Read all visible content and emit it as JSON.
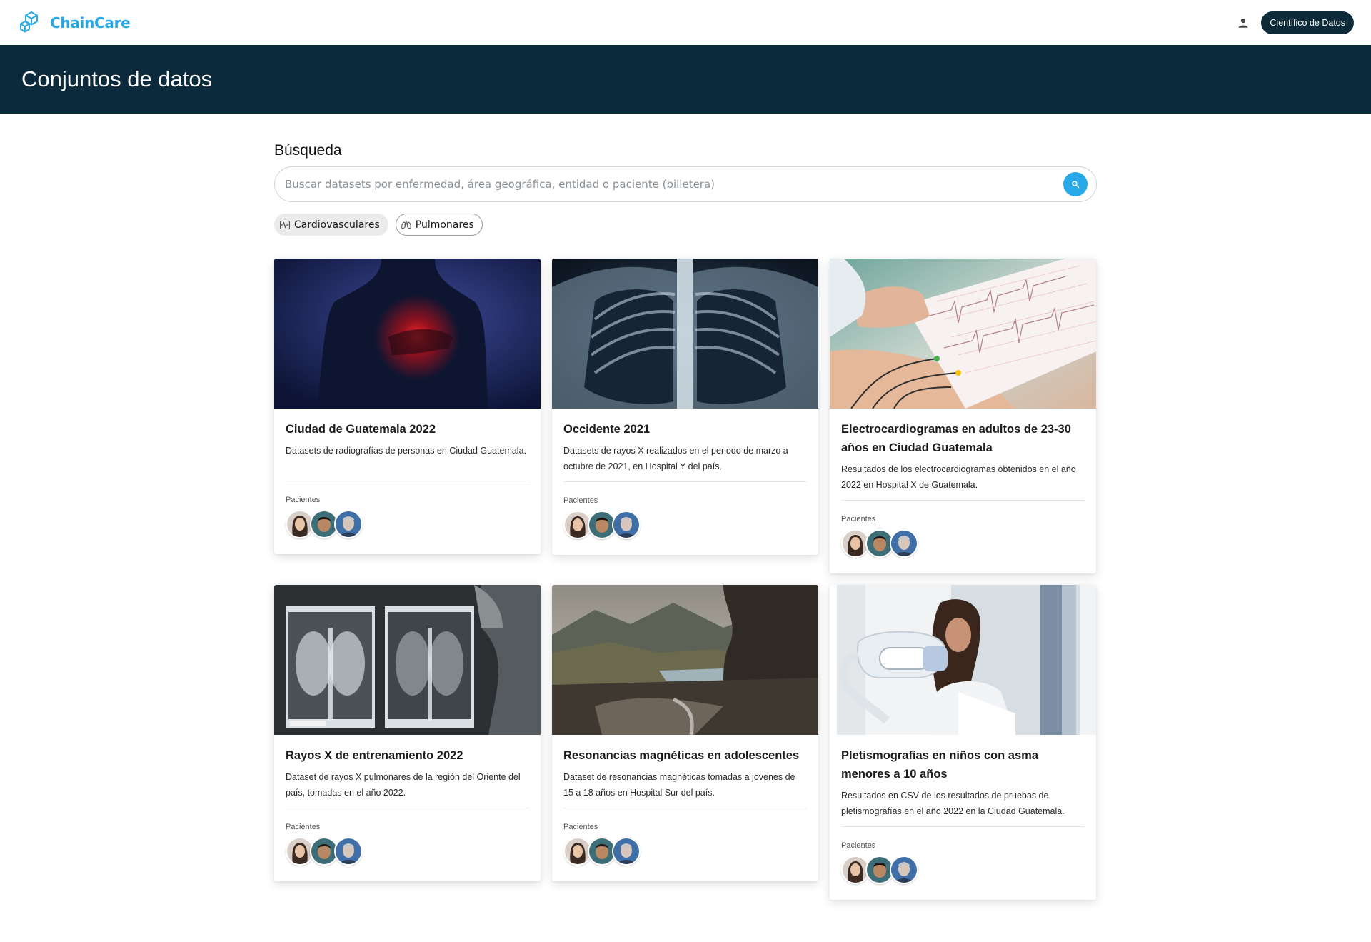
{
  "app": {
    "brand": "ChainCare",
    "role_button": "Científico de Datos"
  },
  "header": {
    "title": "Conjuntos de datos"
  },
  "search": {
    "title": "Búsqueda",
    "placeholder": "Buscar datasets por enfermedad, área geográfica, entidad o paciente (billetera)"
  },
  "chips": [
    {
      "label": "Cardiovasculares",
      "icon": "cardio-icon",
      "style": "filled"
    },
    {
      "label": "Pulmonares",
      "icon": "lungs-icon",
      "style": "outlined"
    }
  ],
  "cards": [
    {
      "title": "Ciudad de Guatemala 2022",
      "description": "Datasets de radiografías de personas en Ciudad Guatemala.",
      "patients_label": "Pacientes",
      "image": "chest-pain-photo"
    },
    {
      "title": "Occidente 2021",
      "description": "Datasets de rayos X realizados en el periodo de marzo a octubre de 2021, en Hospital Y del país.",
      "patients_label": "Pacientes",
      "image": "chest-xray-photo"
    },
    {
      "title": "Electrocardiogramas en adultos de 23-30 años en Ciudad Guatemala",
      "description": "Resultados de los electrocardiogramas obtenidos en el año 2022 en Hospital X de Guatemala.",
      "patients_label": "Pacientes",
      "image": "ecg-photo"
    },
    {
      "title": "Rayos X de entrenamiento 2022",
      "description": "Dataset de rayos X pulmonares de la región del Oriente del país, tomadas en el año 2022.",
      "patients_label": "Pacientes",
      "image": "xray-viewer-photo"
    },
    {
      "title": "Resonancias magnéticas en adolescentes",
      "description": "Dataset de resonancias magnéticas tomadas a jovenes de 15 a 18 años en Hospital Sur del país.",
      "patients_label": "Pacientes",
      "image": "mountain-lake-photo"
    },
    {
      "title": "Pletismografías en niños con asma menores a 10 años",
      "description": "Resultados en CSV de los resultados de pruebas de pletismografías en el año 2022 en la Ciudad Guatemala.",
      "patients_label": "Pacientes",
      "image": "plethysmography-photo"
    }
  ],
  "colors": {
    "brand": "#29a8e6",
    "header_bg": "#0b2a3c",
    "search_button": "#2aa9e8"
  }
}
